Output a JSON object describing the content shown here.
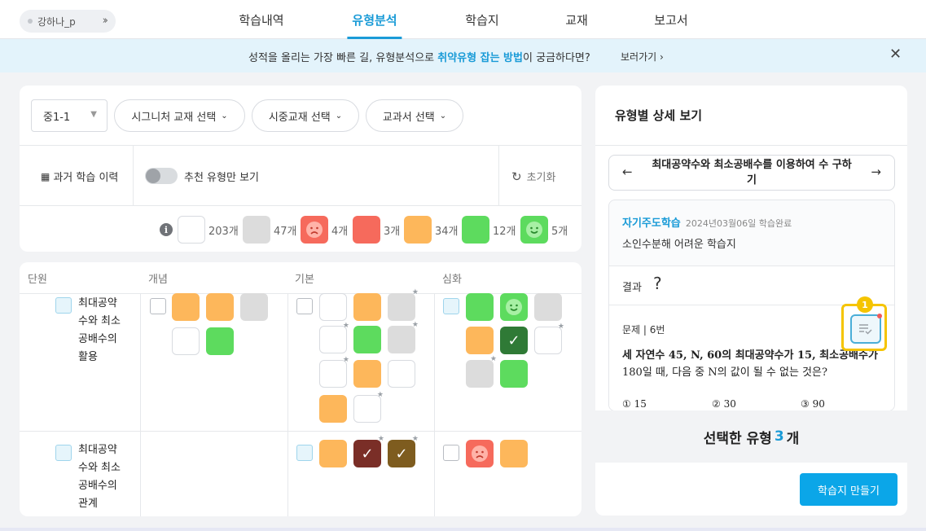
{
  "header": {
    "user": "강하나_p",
    "nav": [
      "학습내역",
      "유형분석",
      "학습지",
      "교재",
      "보고서"
    ],
    "active_nav": "유형분석"
  },
  "banner": {
    "text_before": "성적을 올리는 가장 빠른 길, 유형분석으로 ",
    "highlight": "취약유형 잡는 방법",
    "text_after": "이 궁금하다면?",
    "link": "보러가기 ›",
    "close": "✕"
  },
  "filters": {
    "grade": "중1-1",
    "signature": "시그니처 교재 선택",
    "market": "시중교재 선택",
    "textbook": "교과서 선택",
    "history": "과거 학습 이력",
    "recommend_toggle": "추천 유형만 보기",
    "reset": "초기화"
  },
  "legend": [
    {
      "kind": "empty",
      "count": "203개"
    },
    {
      "kind": "gray",
      "count": "47개"
    },
    {
      "kind": "sad",
      "count": "4개"
    },
    {
      "kind": "red",
      "count": "3개"
    },
    {
      "kind": "orange",
      "count": "34개"
    },
    {
      "kind": "green",
      "count": "12개"
    },
    {
      "kind": "smile",
      "count": "5개"
    }
  ],
  "table": {
    "headers": [
      "단원",
      "개념",
      "기본",
      "심화"
    ],
    "rows": [
      {
        "unit": "최대공약수와 최소공배수의 활용",
        "unit_lines": [
          "최대공약",
          "수와 최소",
          "공배수의",
          "활용"
        ]
      },
      {
        "unit": "최대공약수와 최소공배수의 관계",
        "unit_lines": [
          "최대공약",
          "수와 최소",
          "공배수의",
          "관계"
        ]
      }
    ]
  },
  "detail": {
    "title": "유형별 상세 보기",
    "type_name": "최대공약수와 최소공배수를 이용하여 수 구하기",
    "type_name_lines": [
      "최대공약수와 최소공배수를 이용하여 수 구하",
      "기"
    ],
    "source": "자기주도학습",
    "date": "2024년03월06일 학습완료",
    "worksheet": "소인수분해 어려운 학습지",
    "result_label": "결과",
    "result_mark": "?",
    "problem_label": "문제 | 6번",
    "problem_text_1": "세 자연수 45, N, 60의 최대공약수가 15, 최소공배수가",
    "problem_text_2": "180일 때, 다음 중 N의 값이 될 수 없는 것은?",
    "choices": [
      "① 15",
      "② 30",
      "③ 90"
    ],
    "badge": "1"
  },
  "footer": {
    "selected_prefix": "선택한 유형 ",
    "selected_count": "3",
    "selected_suffix": " 개",
    "make_button": "학습지 만들기"
  },
  "colors": {
    "accent": "#1a9bd7",
    "orange": "#fdb75b",
    "green": "#5ddb5e",
    "gray": "#dcdcdc",
    "red": "#f66a5c",
    "highlight_frame": "#f5c400"
  }
}
